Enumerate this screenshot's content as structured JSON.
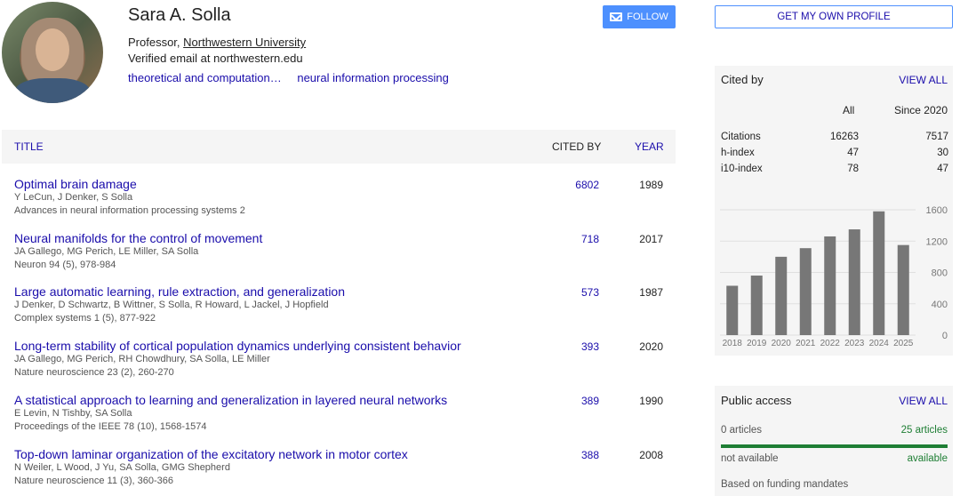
{
  "profile": {
    "name": "Sara A. Solla",
    "role_prefix": "Professor, ",
    "institution": "Northwestern University",
    "email": "Verified email at northwestern.edu",
    "interests": [
      "theoretical and computation…",
      "neural information processing"
    ],
    "follow_label": "FOLLOW"
  },
  "table": {
    "title_header": "TITLE",
    "cited_header": "CITED BY",
    "year_header": "YEAR",
    "rows": [
      {
        "title": "Optimal brain damage",
        "authors": "Y LeCun, J Denker, S Solla",
        "venue": "Advances in neural information processing systems 2",
        "cites": "6802",
        "year": "1989"
      },
      {
        "title": "Neural manifolds for the control of movement",
        "authors": "JA Gallego, MG Perich, LE Miller, SA Solla",
        "venue": "Neuron 94 (5), 978-984",
        "cites": "718",
        "year": "2017"
      },
      {
        "title": "Large automatic learning, rule extraction, and generalization",
        "authors": "J Denker, D Schwartz, B Wittner, S Solla, R Howard, L Jackel, J Hopfield",
        "venue": "Complex systems 1 (5), 877-922",
        "cites": "573",
        "year": "1987"
      },
      {
        "title": "Long-term stability of cortical population dynamics underlying consistent behavior",
        "authors": "JA Gallego, MG Perich, RH Chowdhury, SA Solla, LE Miller",
        "venue": "Nature neuroscience 23 (2), 260-270",
        "cites": "393",
        "year": "2020"
      },
      {
        "title": "A statistical approach to learning and generalization in layered neural networks",
        "authors": "E Levin, N Tishby, SA Solla",
        "venue": "Proceedings of the IEEE 78 (10), 1568-1574",
        "cites": "389",
        "year": "1990"
      },
      {
        "title": "Top-down laminar organization of the excitatory network in motor cortex",
        "authors": "N Weiler, L Wood, J Yu, SA Solla, GMG Shepherd",
        "venue": "Nature neuroscience 11 (3), 360-366",
        "cites": "388",
        "year": "2008"
      }
    ]
  },
  "sidebar": {
    "get_profile_label": "GET MY OWN PROFILE",
    "cited_by_label": "Cited by",
    "view_all_label": "VIEW ALL",
    "col_all": "All",
    "col_since": "Since 2020",
    "stats": [
      {
        "name": "Citations",
        "all": "16263",
        "since": "7517"
      },
      {
        "name": "h-index",
        "all": "47",
        "since": "30"
      },
      {
        "name": "i10-index",
        "all": "78",
        "since": "47"
      }
    ],
    "public_access_label": "Public access",
    "pa_view_all_label": "VIEW ALL",
    "pa_left1": "0 articles",
    "pa_right1": "25 articles",
    "pa_left2": "not available",
    "pa_right2": "available",
    "pa_foot": "Based on funding mandates",
    "colors": {
      "link": "#1a0dab",
      "bar": "#777777",
      "available": "#1e7e34"
    }
  },
  "chart_data": {
    "type": "bar",
    "categories": [
      "2018",
      "2019",
      "2020",
      "2021",
      "2022",
      "2023",
      "2024",
      "2025"
    ],
    "values": [
      630,
      760,
      1000,
      1110,
      1260,
      1350,
      1580,
      1150
    ],
    "yticks": [
      "1600",
      "1200",
      "800",
      "400",
      "0"
    ],
    "ylim": [
      0,
      1600
    ],
    "title": "",
    "xlabel": "",
    "ylabel": "",
    "grid": true
  }
}
